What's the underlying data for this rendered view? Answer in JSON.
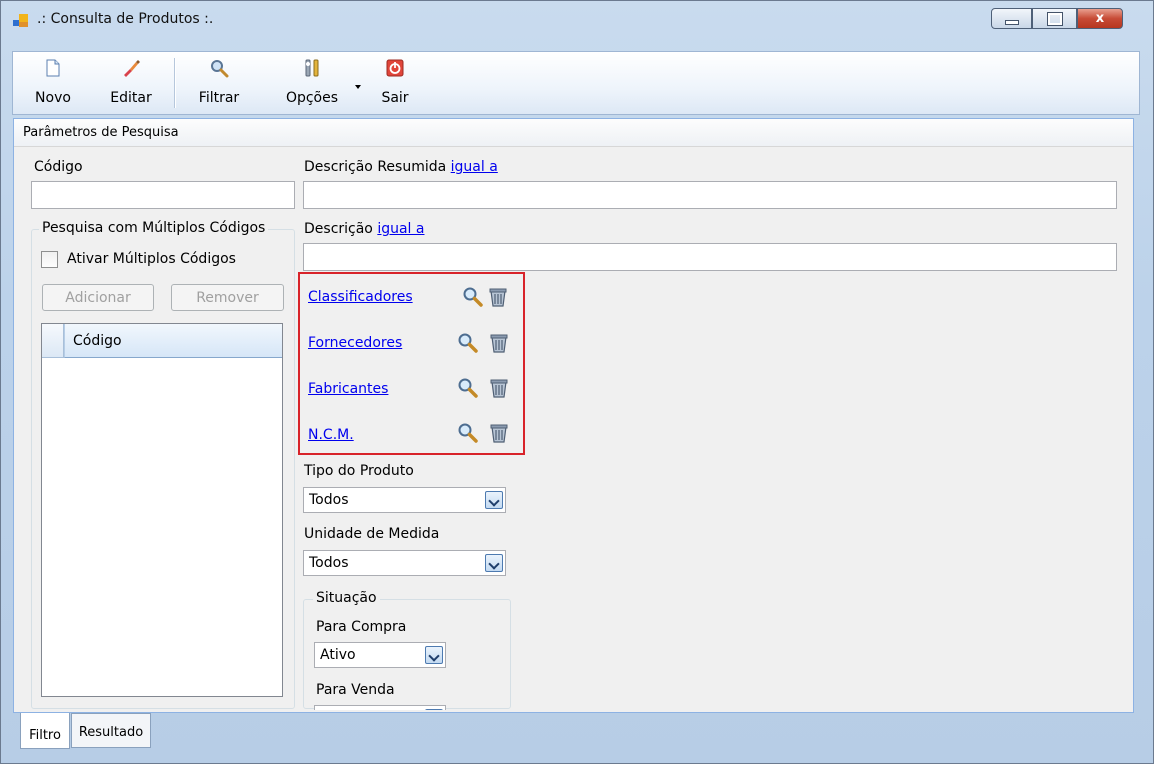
{
  "window": {
    "title": ".: Consulta de Produtos :.",
    "controls": {
      "minimize": "minimize",
      "maximize": "maximize",
      "close": "x"
    }
  },
  "toolbar": {
    "novo": "Novo",
    "editar": "Editar",
    "filtrar": "Filtrar",
    "opcoes": "Opções",
    "sair": "Sair"
  },
  "panel": {
    "header": "Parâmetros de Pesquisa"
  },
  "filters": {
    "codigo_label": "Código",
    "codigo_value": "",
    "desc_resumida_label": "Descrição Resumida",
    "desc_resumida_mode": "igual a",
    "desc_resumida_value": "",
    "descricao_label": "Descrição",
    "descricao_mode": "igual a",
    "descricao_value": ""
  },
  "multi_codes": {
    "group_title": "Pesquisa com Múltiplos Códigos",
    "checkbox_label": "Ativar Múltiplos Códigos",
    "checked": false,
    "add_button": "Adicionar",
    "remove_button": "Remover",
    "grid_column": "Código",
    "rows": []
  },
  "lookups": [
    {
      "label": "Classificadores"
    },
    {
      "label": "Fornecedores"
    },
    {
      "label": "Fabricantes"
    },
    {
      "label": "N.C.M."
    }
  ],
  "tipo_produto": {
    "label": "Tipo do Produto",
    "selected": "Todos"
  },
  "unidade_medida": {
    "label": "Unidade de Medida",
    "selected": "Todos"
  },
  "situacao": {
    "group_title": "Situação",
    "compra_label": "Para Compra",
    "compra_selected": "Ativo",
    "venda_label": "Para Venda"
  },
  "tabs": [
    {
      "label": "Filtro",
      "active": true
    },
    {
      "label": "Resultado",
      "active": false
    }
  ],
  "colors": {
    "highlight_border": "#d8232a",
    "link": "#0000ee",
    "title_gradient": "#c9dbee"
  },
  "icons": {
    "app": "app-icon",
    "novo": "new-document-icon",
    "editar": "edit-brush-icon",
    "filtrar": "magnifier-icon",
    "opcoes": "options-tools-icon",
    "sair": "exit-icon",
    "lookup_search": "search-icon",
    "lookup_clear": "clear-icon"
  }
}
